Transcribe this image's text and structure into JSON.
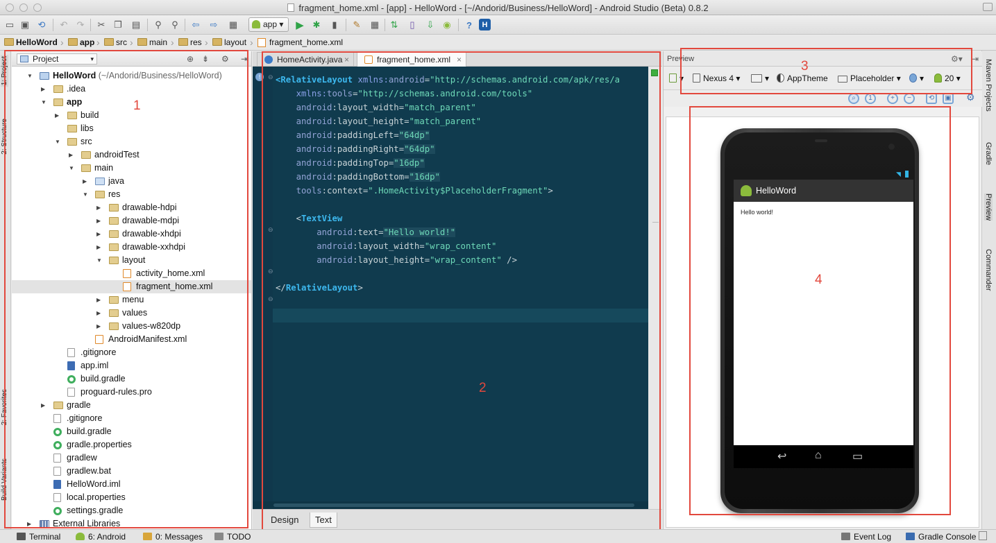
{
  "window": {
    "title": "fragment_home.xml - [app] - HelloWord - [~/Andorid/Business/HelloWord] - Android Studio (Beta) 0.8.2"
  },
  "toolbar": {
    "run_config": "app",
    "icons": [
      "open-icon",
      "save-icon",
      "sync-icon",
      "undo-icon",
      "redo-icon",
      "cut-icon",
      "copy-icon",
      "paste-icon",
      "find-icon",
      "replace-icon",
      "back-icon",
      "forward-icon",
      "run-icon",
      "debug-icon",
      "attach-icon",
      "settings-icon",
      "sdk-icon",
      "avd-icon",
      "gradle-sync-icon",
      "android-icon",
      "help-icon",
      "hierarchy-icon"
    ]
  },
  "breadcrumb": [
    "HelloWord",
    "app",
    "src",
    "main",
    "res",
    "layout",
    "fragment_home.xml"
  ],
  "left_tabs": [
    "1: Project",
    "2: Structure",
    "2: Favorites",
    "Build Variants"
  ],
  "right_tabs": [
    "Maven Projects",
    "Gradle",
    "Preview",
    "Commander"
  ],
  "project": {
    "view_label": "Project",
    "tree": [
      {
        "label": "HelloWord",
        "path": " (~/Andorid/Business/HelloWord)",
        "depth": 0,
        "icon": "mod",
        "arrow": "open",
        "bold": true
      },
      {
        "label": ".idea",
        "depth": 1,
        "icon": "fold",
        "arrow": "closed"
      },
      {
        "label": "app",
        "depth": 1,
        "icon": "fold",
        "arrow": "open",
        "bold": true
      },
      {
        "label": "build",
        "depth": 2,
        "icon": "fold",
        "arrow": "closed"
      },
      {
        "label": "libs",
        "depth": 2,
        "icon": "fold",
        "arrow": "none"
      },
      {
        "label": "src",
        "depth": 2,
        "icon": "fold",
        "arrow": "open"
      },
      {
        "label": "androidTest",
        "depth": 3,
        "icon": "fold",
        "arrow": "closed"
      },
      {
        "label": "main",
        "depth": 3,
        "icon": "fold",
        "arrow": "open"
      },
      {
        "label": "java",
        "depth": 4,
        "icon": "src",
        "arrow": "closed"
      },
      {
        "label": "res",
        "depth": 4,
        "icon": "res",
        "arrow": "open"
      },
      {
        "label": "drawable-hdpi",
        "depth": 5,
        "icon": "fold",
        "arrow": "closed"
      },
      {
        "label": "drawable-mdpi",
        "depth": 5,
        "icon": "fold",
        "arrow": "closed"
      },
      {
        "label": "drawable-xhdpi",
        "depth": 5,
        "icon": "fold",
        "arrow": "closed"
      },
      {
        "label": "drawable-xxhdpi",
        "depth": 5,
        "icon": "fold",
        "arrow": "closed"
      },
      {
        "label": "layout",
        "depth": 5,
        "icon": "fold",
        "arrow": "open"
      },
      {
        "label": "activity_home.xml",
        "depth": 6,
        "icon": "xml",
        "arrow": "none"
      },
      {
        "label": "fragment_home.xml",
        "depth": 6,
        "icon": "xml",
        "arrow": "none",
        "selected": true
      },
      {
        "label": "menu",
        "depth": 5,
        "icon": "fold",
        "arrow": "closed"
      },
      {
        "label": "values",
        "depth": 5,
        "icon": "fold",
        "arrow": "closed"
      },
      {
        "label": "values-w820dp",
        "depth": 5,
        "icon": "fold",
        "arrow": "closed"
      },
      {
        "label": "AndroidManifest.xml",
        "depth": 4,
        "icon": "xml",
        "arrow": "none"
      },
      {
        "label": ".gitignore",
        "depth": 2,
        "icon": "file",
        "arrow": "none"
      },
      {
        "label": "app.iml",
        "depth": 2,
        "icon": "iml",
        "arrow": "none"
      },
      {
        "label": "build.gradle",
        "depth": 2,
        "icon": "grad",
        "arrow": "none"
      },
      {
        "label": "proguard-rules.pro",
        "depth": 2,
        "icon": "file",
        "arrow": "none"
      },
      {
        "label": "gradle",
        "depth": 1,
        "icon": "fold",
        "arrow": "closed"
      },
      {
        "label": ".gitignore",
        "depth": 1,
        "icon": "file",
        "arrow": "none"
      },
      {
        "label": "build.gradle",
        "depth": 1,
        "icon": "grad",
        "arrow": "none"
      },
      {
        "label": "gradle.properties",
        "depth": 1,
        "icon": "grad",
        "arrow": "none"
      },
      {
        "label": "gradlew",
        "depth": 1,
        "icon": "file",
        "arrow": "none"
      },
      {
        "label": "gradlew.bat",
        "depth": 1,
        "icon": "file",
        "arrow": "none"
      },
      {
        "label": "HelloWord.iml",
        "depth": 1,
        "icon": "iml",
        "arrow": "none"
      },
      {
        "label": "local.properties",
        "depth": 1,
        "icon": "file",
        "arrow": "none"
      },
      {
        "label": "settings.gradle",
        "depth": 1,
        "icon": "grad",
        "arrow": "none"
      },
      {
        "label": "External Libraries",
        "depth": 0,
        "icon": "lib",
        "arrow": "closed"
      }
    ]
  },
  "editor": {
    "tabs": [
      {
        "label": "HomeActivity.java",
        "active": false
      },
      {
        "label": "fragment_home.xml",
        "active": true
      }
    ],
    "code_lines": [
      [
        [
          "tag",
          "<RelativeLayout "
        ],
        [
          "ns",
          "xmlns:"
        ],
        [
          "an",
          "android"
        ],
        [
          "t",
          "="
        ],
        [
          "val",
          "\"http://schemas.android.com/apk/res/a"
        ]
      ],
      [
        [
          "t",
          "    "
        ],
        [
          "ns",
          "xmlns:"
        ],
        [
          "an",
          "tools"
        ],
        [
          "t",
          "="
        ],
        [
          "val",
          "\"http://schemas.android.com/tools\""
        ]
      ],
      [
        [
          "t",
          "    "
        ],
        [
          "an",
          "android"
        ],
        [
          "t",
          ":layout_width="
        ],
        [
          "val",
          "\"match_parent\""
        ]
      ],
      [
        [
          "t",
          "    "
        ],
        [
          "an",
          "android"
        ],
        [
          "t",
          ":layout_height="
        ],
        [
          "val",
          "\"match_parent\""
        ]
      ],
      [
        [
          "t",
          "    "
        ],
        [
          "an",
          "android"
        ],
        [
          "t",
          ":paddingLeft="
        ],
        [
          "valbox",
          "\"64dp\""
        ]
      ],
      [
        [
          "t",
          "    "
        ],
        [
          "an",
          "android"
        ],
        [
          "t",
          ":paddingRight="
        ],
        [
          "valbox",
          "\"64dp\""
        ]
      ],
      [
        [
          "t",
          "    "
        ],
        [
          "an",
          "android"
        ],
        [
          "t",
          ":paddingTop="
        ],
        [
          "valbox",
          "\"16dp\""
        ]
      ],
      [
        [
          "t",
          "    "
        ],
        [
          "an",
          "android"
        ],
        [
          "t",
          ":paddingBottom="
        ],
        [
          "valbox",
          "\"16dp\""
        ]
      ],
      [
        [
          "t",
          "    "
        ],
        [
          "an",
          "tools"
        ],
        [
          "t",
          ":context="
        ],
        [
          "val",
          "\".HomeActivity$PlaceholderFragment\""
        ],
        [
          "t",
          ">"
        ]
      ],
      [],
      [
        [
          "t",
          "    <"
        ],
        [
          "tag",
          "TextView"
        ]
      ],
      [
        [
          "t",
          "        "
        ],
        [
          "an",
          "android"
        ],
        [
          "t",
          ":text="
        ],
        [
          "valbox",
          "\"Hello world!\""
        ]
      ],
      [
        [
          "t",
          "        "
        ],
        [
          "an",
          "android"
        ],
        [
          "t",
          ":layout_width="
        ],
        [
          "val",
          "\"wrap_content\""
        ]
      ],
      [
        [
          "t",
          "        "
        ],
        [
          "an",
          "android"
        ],
        [
          "t",
          ":layout_height="
        ],
        [
          "val",
          "\"wrap_content\""
        ],
        [
          "t",
          " />"
        ]
      ],
      [],
      [
        [
          "t",
          "</"
        ],
        [
          "tag",
          "RelativeLayout"
        ],
        [
          "t",
          ">"
        ]
      ]
    ],
    "bottom_tabs": [
      {
        "label": "Design",
        "active": false
      },
      {
        "label": "Text",
        "active": true
      }
    ]
  },
  "preview": {
    "header": "Preview",
    "device": "Nexus 4",
    "theme": "AppTheme",
    "activity": "Placeholder",
    "api": "20",
    "app_title": "HelloWord",
    "hello_text": "Hello world!"
  },
  "annotations": [
    "1",
    "2",
    "3",
    "4"
  ],
  "bottom_bar": [
    {
      "label": "Terminal"
    },
    {
      "label": "6: Android"
    },
    {
      "label": "0: Messages"
    },
    {
      "label": "TODO"
    },
    {
      "label": "Event Log"
    },
    {
      "label": "Gradle Console"
    }
  ],
  "colors": {
    "annotation": "#e2483d",
    "editor_bg": "#103b4e",
    "tag": "#3db8ee",
    "attr": "#93a4d6",
    "value": "#6ed9b8"
  }
}
